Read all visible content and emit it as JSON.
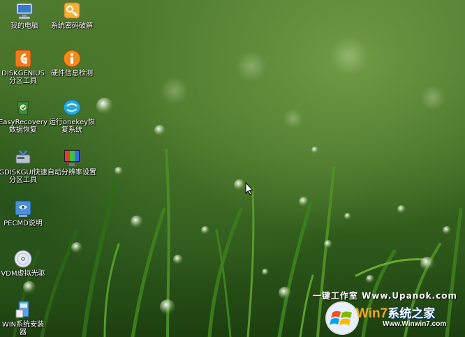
{
  "desktop": {
    "icons": [
      {
        "id": "my-computer",
        "label": "我的电脑"
      },
      {
        "id": "password-crack",
        "label": "系统密码破解"
      },
      {
        "id": "diskgenius",
        "label": "DISKGENIUS分区工具"
      },
      {
        "id": "hardware-detect",
        "label": "硬件信息检测"
      },
      {
        "id": "easyrecovery",
        "label": "EasyRecovery数据恢复"
      },
      {
        "id": "onekey-restore",
        "label": "运行onekey恢复系统"
      },
      {
        "id": "gdiskgui",
        "label": "GDISKGUI快速分区工具"
      },
      {
        "id": "auto-resolution",
        "label": "自动分辨率设置"
      },
      {
        "id": "pecmd-help",
        "label": "PECMD说明"
      },
      {
        "id": "vdm-drive",
        "label": "VDM虚拟光驱"
      },
      {
        "id": "win-install",
        "label": "WIN系统安装器"
      }
    ]
  },
  "watermark": {
    "text": "一键工作室 Www.Upanok.com",
    "brand_w": "W",
    "brand_in7": "in7",
    "brand_cn": "系统之家",
    "brand_url": "Www.Winwin7.com"
  },
  "colors": {
    "accent_orange": "#f2a51f",
    "text": "#ffffff"
  }
}
